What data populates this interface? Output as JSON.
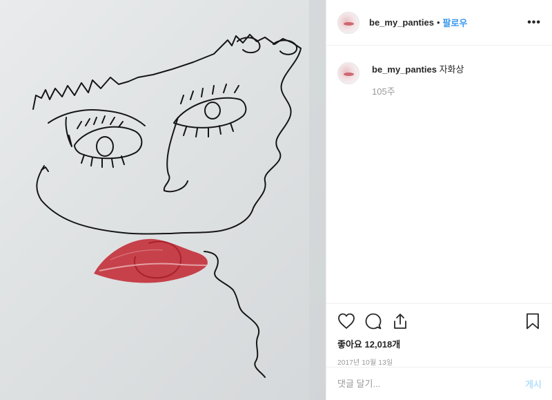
{
  "header": {
    "username": "be_my_panties",
    "separator": "•",
    "follow_label": "팔로우",
    "more_label": "•••"
  },
  "caption": {
    "username": "be_my_panties",
    "text": "자화상",
    "time_ago": "105주"
  },
  "actions": {
    "icons": [
      "heart-icon",
      "comment-icon",
      "share-icon",
      "bookmark-icon"
    ],
    "likes": "좋아요 12,018개",
    "date": "2017년 10월 13일"
  },
  "comment": {
    "placeholder": "댓글 달기...",
    "post_label": "게시"
  },
  "colors": {
    "follow": "#3897f0",
    "post_disabled": "#b2dffc",
    "muted": "#999999",
    "lips": "#c2252f"
  }
}
